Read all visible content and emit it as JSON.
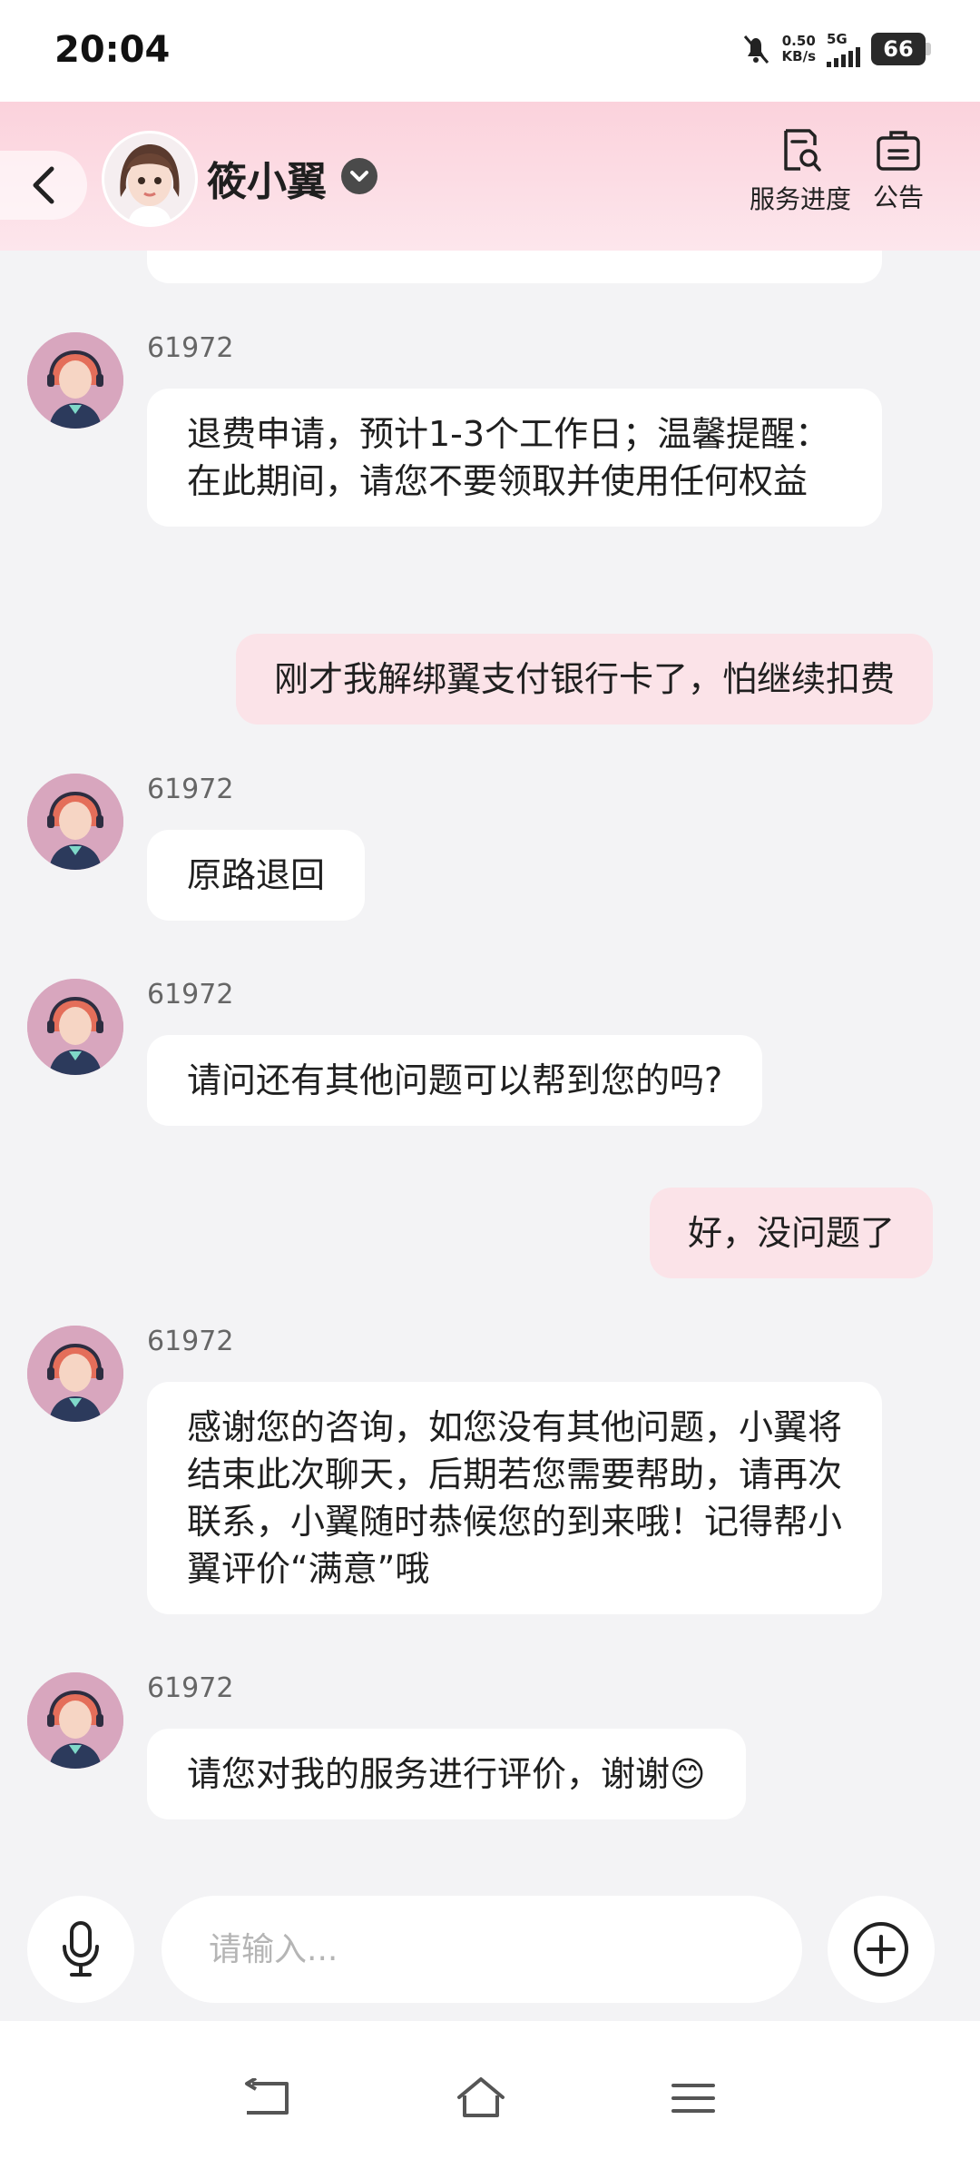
{
  "status_bar": {
    "time": "20:04",
    "net_speed_value": "0.50",
    "net_speed_unit": "KB/s",
    "network": "5G",
    "battery": "66"
  },
  "header": {
    "title": "筱小翼",
    "service_progress_label": "服务进度",
    "notice_label": "公告"
  },
  "messages": [
    {
      "side": "left",
      "sender": "61972",
      "text": "退费申请，预计1-3个工作日；温馨提醒：在此期间，请您不要领取并使用任何权益"
    },
    {
      "side": "right",
      "text": "刚才我解绑翼支付银行卡了，怕继续扣费"
    },
    {
      "side": "left",
      "sender": "61972",
      "text": "原路退回"
    },
    {
      "side": "left",
      "sender": "61972",
      "text": "请问还有其他问题可以帮到您的吗?"
    },
    {
      "side": "right",
      "text": "好，没问题了"
    },
    {
      "side": "left",
      "sender": "61972",
      "text": "感谢您的咨询，如您没有其他问题，小翼将结束此次聊天，后期若您需要帮助，请再次联系，小翼随时恭候您的到来哦！记得帮小翼评价“满意”哦"
    },
    {
      "side": "left",
      "sender": "61972",
      "text": "请您对我的服务进行评价，谢谢",
      "emoji": "😊"
    }
  ],
  "input": {
    "placeholder": "请输入...",
    "value": ""
  },
  "icons": {
    "back": "chevron-left-icon",
    "verified": "chevron-down-icon",
    "service_progress": "document-search-icon",
    "notice": "briefcase-icon",
    "mic": "microphone-icon",
    "plus": "plus-circle-icon",
    "nav_back": "nav-back-icon",
    "nav_home": "home-icon",
    "nav_menu": "menu-icon"
  },
  "colors": {
    "header_pink": "#fbd2dc",
    "user_bubble": "#fbe3e8",
    "agent_bubble": "#ffffff",
    "background": "#f3f3f5"
  }
}
